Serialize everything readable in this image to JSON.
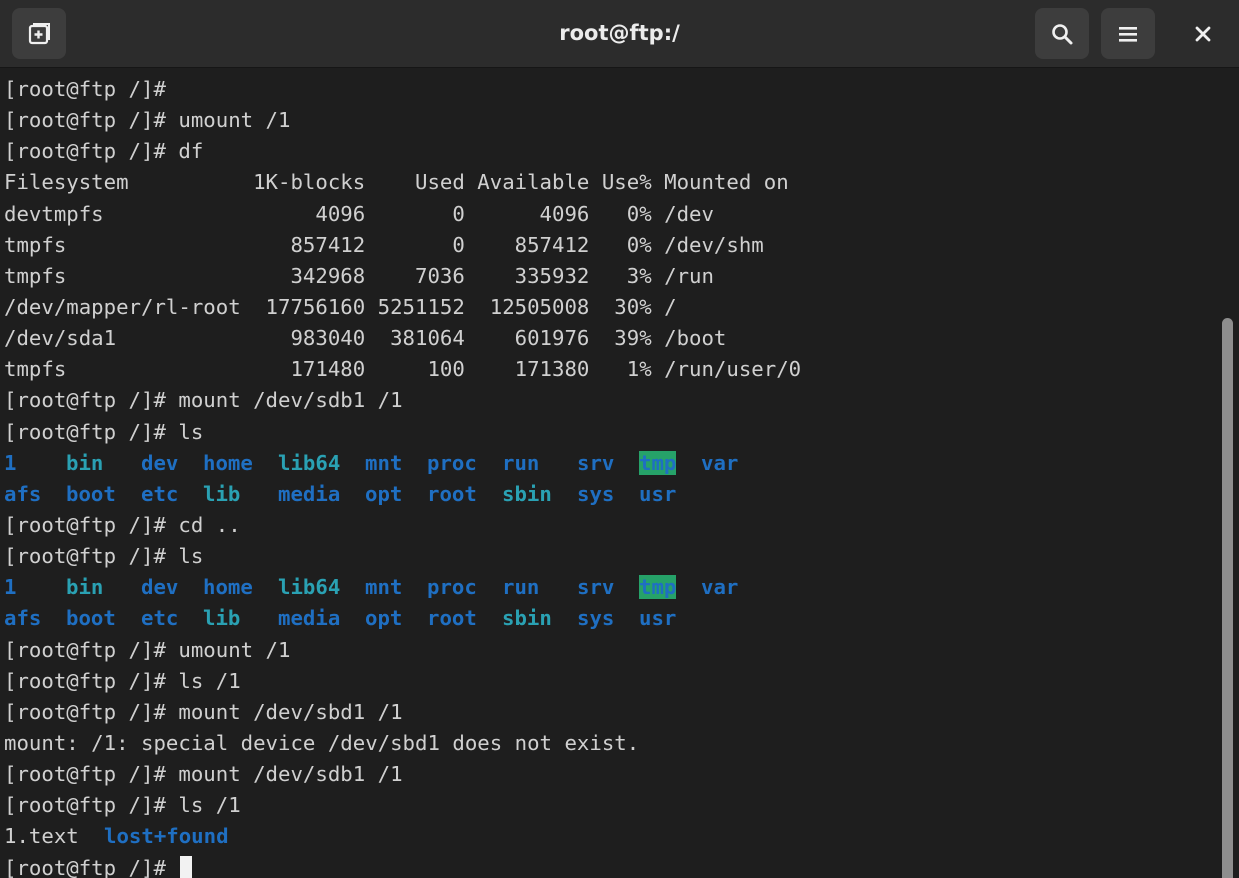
{
  "window": {
    "title": "root@ftp:/"
  },
  "toolbar": {
    "new_tab_icon": "new-tab-icon",
    "search_icon": "search-icon",
    "menu_icon": "hamburger-menu-icon",
    "close_label": "×"
  },
  "terminal": {
    "lines": [
      {
        "text": "[root@ftp /]#"
      },
      {
        "text": "[root@ftp /]# umount /1"
      },
      {
        "text": "[root@ftp /]# df"
      },
      {
        "text": "Filesystem          1K-blocks    Used Available Use% Mounted on"
      },
      {
        "text": "devtmpfs                 4096       0      4096   0% /dev"
      },
      {
        "text": "tmpfs                  857412       0    857412   0% /dev/shm"
      },
      {
        "text": "tmpfs                  342968    7036    335932   3% /run"
      },
      {
        "text": "/dev/mapper/rl-root  17756160 5251152  12505008  30% /"
      },
      {
        "text": "/dev/sda1              983040  381064    601976  39% /boot"
      },
      {
        "text": "tmpfs                  171480     100    171380   1% /run/user/0"
      },
      {
        "text": "[root@ftp /]# mount /dev/sdb1 /1"
      },
      {
        "text": "[root@ftp /]# ls"
      },
      {
        "ls": [
          {
            "t": "1",
            "c": "dir"
          },
          {
            "t": "bin",
            "c": "lnk"
          },
          {
            "t": "dev",
            "c": "dir"
          },
          {
            "t": "home",
            "c": "dir"
          },
          {
            "t": "lib64",
            "c": "lnk"
          },
          {
            "t": "mnt",
            "c": "dir"
          },
          {
            "t": "proc",
            "c": "dir"
          },
          {
            "t": "run",
            "c": "dir"
          },
          {
            "t": "srv",
            "c": "dir"
          },
          {
            "t": "tmp",
            "c": "sticky"
          },
          {
            "t": "var",
            "c": "dir"
          }
        ]
      },
      {
        "ls": [
          {
            "t": "afs",
            "c": "dir"
          },
          {
            "t": "boot",
            "c": "dir"
          },
          {
            "t": "etc",
            "c": "dir"
          },
          {
            "t": "lib",
            "c": "lnk"
          },
          {
            "t": "media",
            "c": "dir"
          },
          {
            "t": "opt",
            "c": "dir"
          },
          {
            "t": "root",
            "c": "dir"
          },
          {
            "t": "sbin",
            "c": "lnk"
          },
          {
            "t": "sys",
            "c": "dir"
          },
          {
            "t": "usr",
            "c": "dir"
          }
        ]
      },
      {
        "text": "[root@ftp /]# cd .."
      },
      {
        "text": "[root@ftp /]# ls"
      },
      {
        "ls": [
          {
            "t": "1",
            "c": "dir"
          },
          {
            "t": "bin",
            "c": "lnk"
          },
          {
            "t": "dev",
            "c": "dir"
          },
          {
            "t": "home",
            "c": "dir"
          },
          {
            "t": "lib64",
            "c": "lnk"
          },
          {
            "t": "mnt",
            "c": "dir"
          },
          {
            "t": "proc",
            "c": "dir"
          },
          {
            "t": "run",
            "c": "dir"
          },
          {
            "t": "srv",
            "c": "dir"
          },
          {
            "t": "tmp",
            "c": "sticky"
          },
          {
            "t": "var",
            "c": "dir"
          }
        ]
      },
      {
        "ls": [
          {
            "t": "afs",
            "c": "dir"
          },
          {
            "t": "boot",
            "c": "dir"
          },
          {
            "t": "etc",
            "c": "dir"
          },
          {
            "t": "lib",
            "c": "lnk"
          },
          {
            "t": "media",
            "c": "dir"
          },
          {
            "t": "opt",
            "c": "dir"
          },
          {
            "t": "root",
            "c": "dir"
          },
          {
            "t": "sbin",
            "c": "lnk"
          },
          {
            "t": "sys",
            "c": "dir"
          },
          {
            "t": "usr",
            "c": "dir"
          }
        ]
      },
      {
        "text": "[root@ftp /]# umount /1"
      },
      {
        "text": "[root@ftp /]# ls /1"
      },
      {
        "text": "[root@ftp /]# mount /dev/sbd1 /1"
      },
      {
        "text": "mount: /1: special device /dev/sbd1 does not exist."
      },
      {
        "text": "[root@ftp /]# mount /dev/sdb1 /1"
      },
      {
        "text": "[root@ftp /]# ls /1"
      },
      {
        "ls2": [
          {
            "t": "1.text",
            "c": "plain"
          },
          {
            "t": "lost+found",
            "c": "dir"
          }
        ]
      },
      {
        "text": "[root@ftp /]# ",
        "cursor": true
      }
    ]
  },
  "colors": {
    "background": "#1e1e1e",
    "titlebar": "#2c2c2c",
    "foreground": "#d0d0d0",
    "directory": "#1f6fc2",
    "symlink": "#2aa1b3",
    "sticky_bg": "#26a269"
  }
}
